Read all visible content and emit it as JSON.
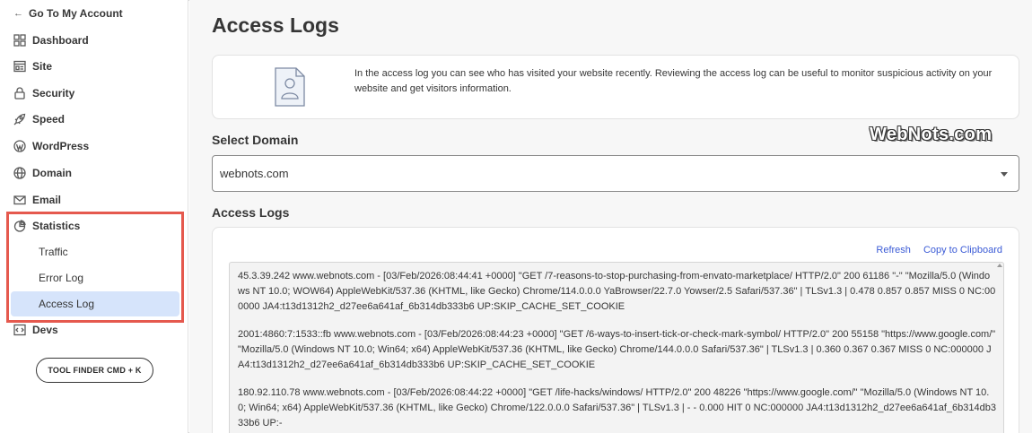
{
  "sidebar": {
    "back_label": "Go To My Account",
    "items": [
      {
        "label": "Dashboard",
        "icon": "grid-icon"
      },
      {
        "label": "Site",
        "icon": "site-icon"
      },
      {
        "label": "Security",
        "icon": "lock-icon"
      },
      {
        "label": "Speed",
        "icon": "rocket-icon"
      },
      {
        "label": "WordPress",
        "icon": "wordpress-icon"
      },
      {
        "label": "Domain",
        "icon": "globe-icon"
      },
      {
        "label": "Email",
        "icon": "envelope-icon"
      },
      {
        "label": "Statistics",
        "icon": "pie-chart-icon"
      },
      {
        "label": "Devs",
        "icon": "code-icon"
      }
    ],
    "statistics_sub": [
      "Traffic",
      "Error Log",
      "Access Log"
    ],
    "active_sub": "Access Log",
    "tool_finder_label": "TOOL FINDER CMD + K"
  },
  "main": {
    "title": "Access Logs",
    "info_text": "In the access log you can see who has visited your website recently. Reviewing the access log can be useful to monitor suspicious activity on your website and get visitors information.",
    "select_domain_label": "Select Domain",
    "watermark": "WebNots.com",
    "domain_value": "webnots.com",
    "logs_label": "Access Logs",
    "refresh_label": "Refresh",
    "copy_label": "Copy to Clipboard",
    "log_entries": [
      "45.3.39.242 www.webnots.com - [03/Feb/2026:08:44:41 +0000] \"GET /7-reasons-to-stop-purchasing-from-envato-marketplace/ HTTP/2.0\" 200 61186 \"-\" \"Mozilla/5.0 (Windows NT 10.0; WOW64) AppleWebKit/537.36 (KHTML, like Gecko) Chrome/114.0.0.0 YaBrowser/22.7.0 Yowser/2.5 Safari/537.36\" | TLSv1.3 | 0.478 0.857 0.857 MISS 0 NC:000000 JA4:t13d1312h2_d27ee6a641af_6b314db333b6 UP:SKIP_CACHE_SET_COOKIE",
      "2001:4860:7:1533::fb www.webnots.com - [03/Feb/2026:08:44:23 +0000] \"GET /6-ways-to-insert-tick-or-check-mark-symbol/ HTTP/2.0\" 200 55158 \"https://www.google.com/\" \"Mozilla/5.0 (Windows NT 10.0; Win64; x64) AppleWebKit/537.36 (KHTML, like Gecko) Chrome/144.0.0.0 Safari/537.36\" | TLSv1.3 | 0.360 0.367 0.367 MISS 0 NC:000000 JA4:t13d1312h2_d27ee6a641af_6b314db333b6 UP:SKIP_CACHE_SET_COOKIE",
      "180.92.110.78 www.webnots.com - [03/Feb/2026:08:44:22 +0000] \"GET /life-hacks/windows/ HTTP/2.0\" 200 48226 \"https://www.google.com/\" \"Mozilla/5.0 (Windows NT 10.0; Win64; x64) AppleWebKit/537.36 (KHTML, like Gecko) Chrome/122.0.0.0 Safari/537.36\" | TLSv1.3 | - - 0.000 HIT 0 NC:000000 JA4:t13d1312h2_d27ee6a641af_6b314db333b6 UP:-"
    ]
  },
  "colors": {
    "accent_link": "#3b5bd6",
    "active_bg": "#d6e4fb",
    "highlight_border": "#e5594e"
  }
}
